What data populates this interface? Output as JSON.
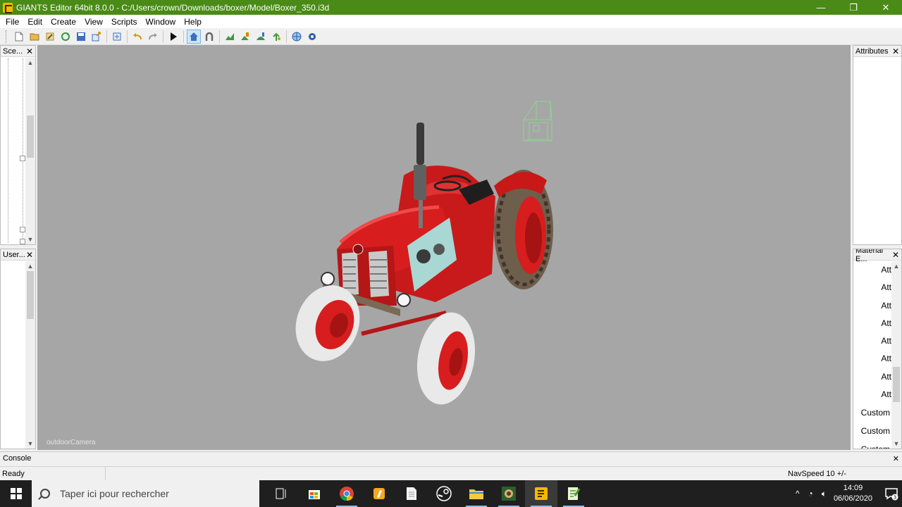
{
  "window": {
    "title": "GIANTS Editor 64bit 8.0.0 - C:/Users/crown/Downloads/boxer/Model/Boxer_350.i3d",
    "minimize": "—",
    "restore": "❐",
    "close": "✕"
  },
  "menu": [
    "File",
    "Edit",
    "Create",
    "View",
    "Scripts",
    "Window",
    "Help"
  ],
  "panels": {
    "scenegraph_title": "Sce...",
    "user_title": "User...",
    "attributes_title": "Attributes",
    "material_title": "Material E...",
    "close_glyph": "✕",
    "material_rows": [
      "Att",
      "Att",
      "Att",
      "Att",
      "Att",
      "Att",
      "Att",
      "Att",
      "Custom",
      "Custom",
      "Custom"
    ]
  },
  "viewport": {
    "camera_label": "outdoorCamera",
    "background": "#a6a6a6"
  },
  "console": {
    "title": "Console",
    "close_glyph": "✕"
  },
  "status": {
    "ready": "Ready",
    "navspeed": "NavSpeed 10 +/-"
  },
  "taskbar": {
    "search_placeholder": "Taper ici pour rechercher",
    "time": "14:09",
    "date": "06/06/2020",
    "notification_count": "3"
  },
  "colors": {
    "titlebar": "#4a8a16",
    "tractor_red": "#d71d1d"
  }
}
